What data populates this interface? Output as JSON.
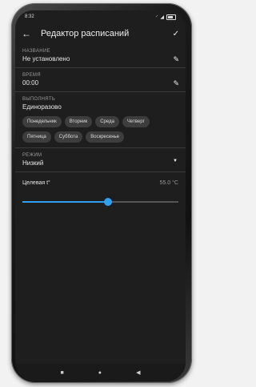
{
  "status": {
    "time": "8:32"
  },
  "appbar": {
    "title": "Редактор расписаний"
  },
  "name_section": {
    "label": "НАЗВАНИЕ",
    "value": "Не установлено"
  },
  "time_section": {
    "label": "ВРЕМЯ",
    "value": "00:00"
  },
  "run_section": {
    "label": "ВЫПОЛНЯТЬ",
    "value": "Единоразово",
    "days": [
      "Понедельник",
      "Вторник",
      "Среда",
      "Четверг",
      "Пятница",
      "Суббота",
      "Воскресенье"
    ]
  },
  "mode_section": {
    "label": "РЕЖИМ",
    "value": "Низкий"
  },
  "target": {
    "label": "Целевая t°",
    "value": "55.0 °C",
    "slider_fraction": 0.55
  },
  "colors": {
    "accent": "#2f9ff0",
    "background": "#1e1e1e"
  }
}
